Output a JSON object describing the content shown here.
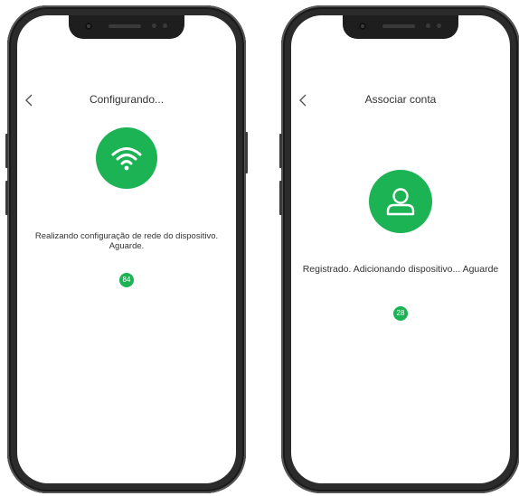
{
  "accent_color": "#1cb354",
  "screens": [
    {
      "title": "Configurando...",
      "icon": "wifi-icon",
      "message": "Realizando configuração de rede do dispositivo. Aguarde.",
      "progress": "84"
    },
    {
      "title": "Associar conta",
      "icon": "user-icon",
      "message": "Registrado. Adicionando dispositivo... Aguarde",
      "progress": "28"
    }
  ]
}
